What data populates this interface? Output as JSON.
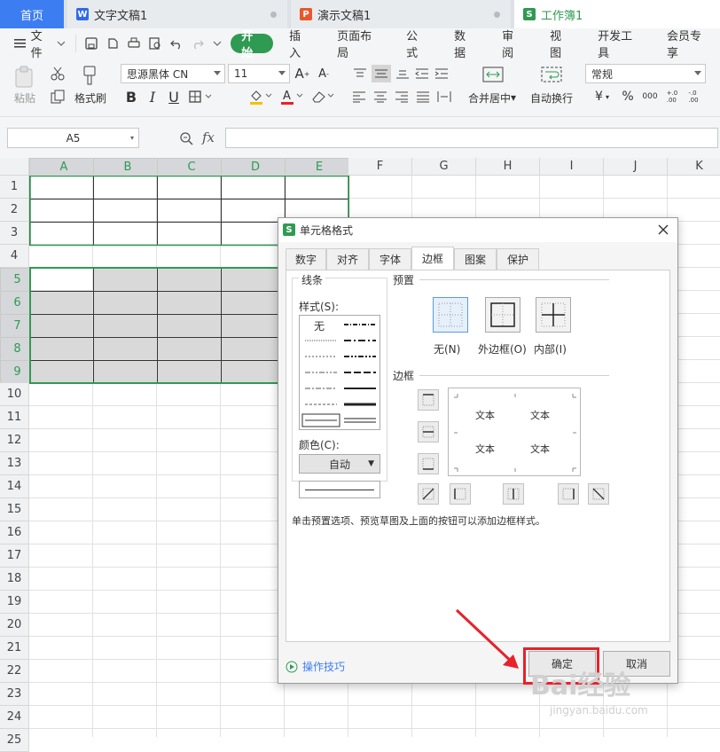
{
  "tabs": {
    "home": "首页",
    "doc1": "文字文稿1",
    "ppt1": "演示文稿1",
    "sheet1": "工作簿1"
  },
  "menu": {
    "file": "文件",
    "items": [
      "开始",
      "插入",
      "页面布局",
      "公式",
      "数据",
      "审阅",
      "视图",
      "开发工具",
      "会员专享"
    ]
  },
  "ribbon": {
    "paste": "粘贴",
    "format_painter": "格式刷",
    "font_name": "思源黑体 CN",
    "font_size": "11",
    "merge_center": "合并居中",
    "wrap_text": "自动换行",
    "number_format": "常规",
    "currency": "¥",
    "percent": "%",
    "thousands": "000",
    "dec_inc": "+.0\n.00",
    "dec_dec": "-.0\n.00"
  },
  "formula_bar": {
    "name_box": "A5",
    "fx": "fx"
  },
  "sheet": {
    "columns": [
      "A",
      "B",
      "C",
      "D",
      "E",
      "F",
      "G",
      "H",
      "I",
      "J",
      "K"
    ],
    "rows": [
      "1",
      "2",
      "3",
      "4",
      "5",
      "6",
      "7",
      "8",
      "9",
      "10",
      "11",
      "12",
      "13",
      "14",
      "15",
      "16",
      "17",
      "18",
      "19",
      "20",
      "21",
      "22",
      "23",
      "24",
      "25"
    ]
  },
  "dialog": {
    "title": "单元格格式",
    "tabs": [
      "数字",
      "对齐",
      "字体",
      "边框",
      "图案",
      "保护"
    ],
    "line_group": "线条",
    "style_label": "样式(S):",
    "style_none": "无",
    "color_label": "颜色(C):",
    "color_value": "自动",
    "preset_group": "预置",
    "preset_none": "无(N)",
    "preset_outline": "外边框(O)",
    "preset_inside": "内部(I)",
    "border_group": "边框",
    "preview_text": "文本",
    "hint": "单击预置选项、预览草图及上面的按钮可以添加边框样式。",
    "tips": "操作技巧",
    "ok": "确定",
    "cancel": "取消"
  },
  "watermark": {
    "brand": "Bai经验",
    "url": "jingyan.baidu.com"
  },
  "colors": {
    "green_accent": "#2f9a52",
    "blue_tab": "#3c7df2",
    "red_annotation": "#e8212a",
    "selection_fill": "#d9d9d9"
  }
}
